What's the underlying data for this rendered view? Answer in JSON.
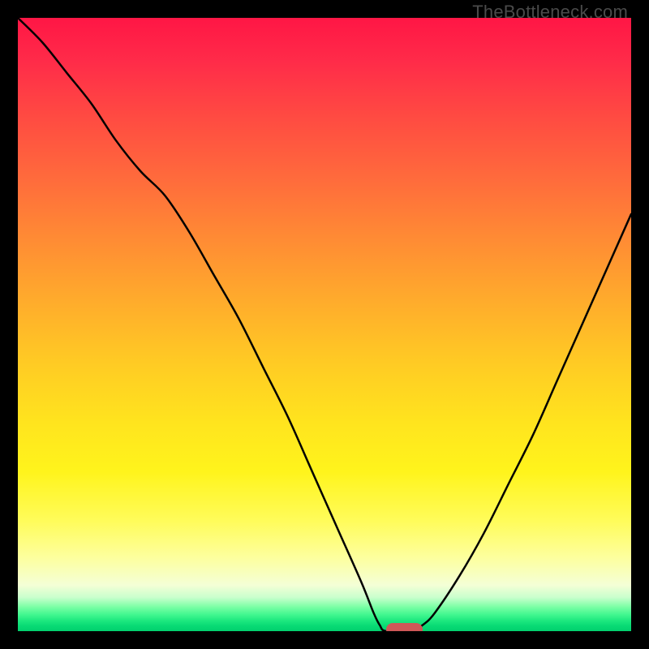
{
  "watermark": "TheBottleneck.com",
  "colors": {
    "frame": "#000000",
    "curve": "#000000",
    "marker": "#cf5858",
    "gradient_top": "#ff1645",
    "gradient_bottom": "#02d06e"
  },
  "chart_data": {
    "type": "line",
    "title": "",
    "xlabel": "",
    "ylabel": "",
    "xlim": [
      0,
      100
    ],
    "ylim": [
      0,
      100
    ],
    "note": "x is normalized horizontal position (0=left, 100=right); y is bottleneck percentage (0=green/no bottleneck at bottom, 100=red/severe at top). Single V-shaped curve; optimum near x≈62 where y≈0.",
    "curve": [
      {
        "x": 0,
        "y": 100
      },
      {
        "x": 4,
        "y": 96
      },
      {
        "x": 8,
        "y": 91
      },
      {
        "x": 12,
        "y": 86
      },
      {
        "x": 16,
        "y": 80
      },
      {
        "x": 20,
        "y": 75
      },
      {
        "x": 24,
        "y": 71
      },
      {
        "x": 28,
        "y": 65
      },
      {
        "x": 32,
        "y": 58
      },
      {
        "x": 36,
        "y": 51
      },
      {
        "x": 40,
        "y": 43
      },
      {
        "x": 44,
        "y": 35
      },
      {
        "x": 48,
        "y": 26
      },
      {
        "x": 52,
        "y": 17
      },
      {
        "x": 56,
        "y": 8
      },
      {
        "x": 58,
        "y": 3
      },
      {
        "x": 59,
        "y": 1
      },
      {
        "x": 60,
        "y": 0
      },
      {
        "x": 64,
        "y": 0
      },
      {
        "x": 66,
        "y": 1
      },
      {
        "x": 68,
        "y": 3
      },
      {
        "x": 72,
        "y": 9
      },
      {
        "x": 76,
        "y": 16
      },
      {
        "x": 80,
        "y": 24
      },
      {
        "x": 84,
        "y": 32
      },
      {
        "x": 88,
        "y": 41
      },
      {
        "x": 92,
        "y": 50
      },
      {
        "x": 96,
        "y": 59
      },
      {
        "x": 100,
        "y": 68
      }
    ],
    "marker": {
      "x_start": 60,
      "x_end": 66,
      "y": 0
    }
  }
}
